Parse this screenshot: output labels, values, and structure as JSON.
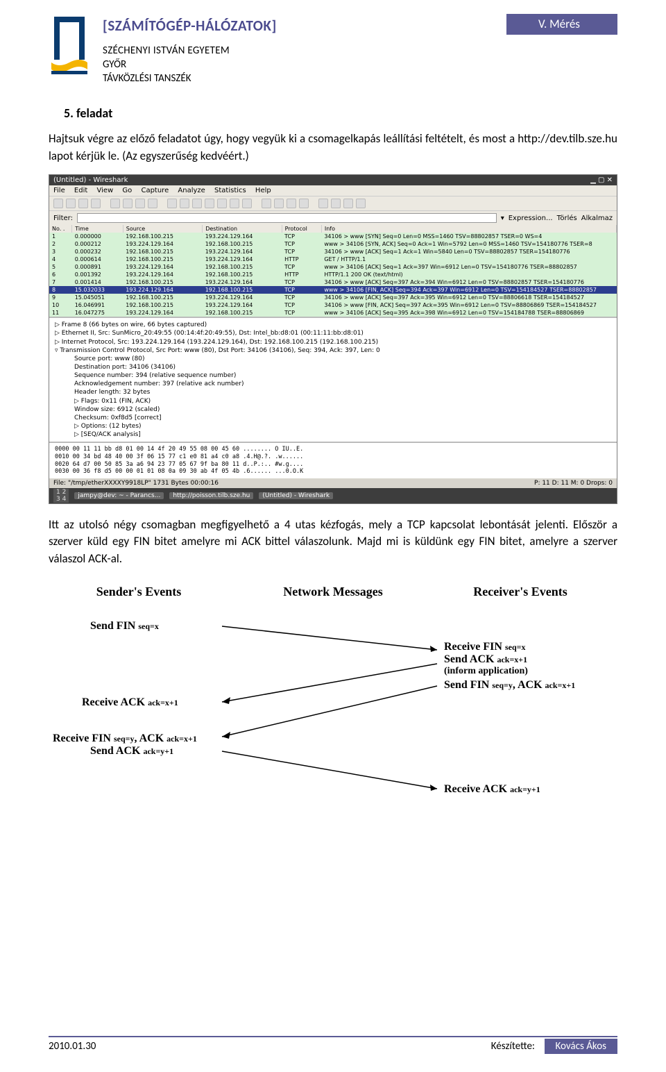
{
  "header": {
    "course_title": "[SZÁMÍTÓGÉP-HÁLÓZATOK]",
    "measurement_label": "V. Mérés",
    "university": "SZÉCHENYI ISTVÁN EGYETEM",
    "city": "GYŐR",
    "department": "TÁVKÖZLÉSI TANSZÉK"
  },
  "task": {
    "heading": "5. feladat",
    "para1": "Hajtsuk végre az előző feladatot úgy, hogy vegyük ki a csomagelkapás leállítási feltételt, és most a http://dev.tilb.sze.hu lapot kérjük le. (Az egyszerűség kedvéért.)",
    "para2": "Itt az utolsó négy csomagban megfigyelhető a 4 utas kézfogás, mely a TCP kapcsolat lebontását jelenti. Először a szerver küld egy FIN bitet amelyre mi ACK bittel válaszolunk. Majd mi is küldünk egy FIN bitet, amelyre a szerver válaszol ACK-al."
  },
  "wireshark": {
    "window_title": "(Untitled) - Wireshark",
    "menu": [
      "File",
      "Edit",
      "View",
      "Go",
      "Capture",
      "Analyze",
      "Statistics",
      "Help"
    ],
    "filter_label": "Filter:",
    "filter_buttons": [
      "Expression...",
      "Törlés",
      "Alkalmaz"
    ],
    "columns": [
      "No. .",
      "Time",
      "Source",
      "Destination",
      "Protocol",
      "Info"
    ],
    "rows": [
      {
        "no": "1",
        "time": "0.000000",
        "src": "192.168.100.215",
        "dst": "193.224.129.164",
        "proto": "TCP",
        "info": "34106 > www [SYN] Seq=0 Len=0 MSS=1460 TSV=88802857 TSER=0 WS=4",
        "cls": "g"
      },
      {
        "no": "2",
        "time": "0.000212",
        "src": "193.224.129.164",
        "dst": "192.168.100.215",
        "proto": "TCP",
        "info": "www > 34106 [SYN, ACK] Seq=0 Ack=1 Win=5792 Len=0 MSS=1460 TSV=154180776 TSER=8",
        "cls": "g"
      },
      {
        "no": "3",
        "time": "0.000232",
        "src": "192.168.100.215",
        "dst": "193.224.129.164",
        "proto": "TCP",
        "info": "34106 > www [ACK] Seq=1 Ack=1 Win=5840 Len=0 TSV=88802857 TSER=154180776",
        "cls": "g"
      },
      {
        "no": "4",
        "time": "0.000614",
        "src": "192.168.100.215",
        "dst": "193.224.129.164",
        "proto": "HTTP",
        "info": "GET / HTTP/1.1",
        "cls": "g"
      },
      {
        "no": "5",
        "time": "0.000891",
        "src": "193.224.129.164",
        "dst": "192.168.100.215",
        "proto": "TCP",
        "info": "www > 34106 [ACK] Seq=1 Ack=397 Win=6912 Len=0 TSV=154180776 TSER=88802857",
        "cls": "g"
      },
      {
        "no": "6",
        "time": "0.001392",
        "src": "193.224.129.164",
        "dst": "192.168.100.215",
        "proto": "HTTP",
        "info": "HTTP/1.1 200 OK (text/html)",
        "cls": "g"
      },
      {
        "no": "7",
        "time": "0.001414",
        "src": "192.168.100.215",
        "dst": "193.224.129.164",
        "proto": "TCP",
        "info": "34106 > www [ACK] Seq=397 Ack=394 Win=6912 Len=0 TSV=88802857 TSER=154180776",
        "cls": "g"
      },
      {
        "no": "8",
        "time": "15.032033",
        "src": "193.224.129.164",
        "dst": "192.168.100.215",
        "proto": "TCP",
        "info": "www > 34106 [FIN, ACK] Seq=394 Ack=397 Win=6912 Len=0 TSV=154184527 TSER=88802857",
        "cls": "sel"
      },
      {
        "no": "9",
        "time": "15.045051",
        "src": "192.168.100.215",
        "dst": "193.224.129.164",
        "proto": "TCP",
        "info": "34106 > www [ACK] Seq=397 Ack=395 Win=6912 Len=0 TSV=88806618 TSER=154184527",
        "cls": "g"
      },
      {
        "no": "10",
        "time": "16.046991",
        "src": "192.168.100.215",
        "dst": "193.224.129.164",
        "proto": "TCP",
        "info": "34106 > www [FIN, ACK] Seq=397 Ack=395 Win=6912 Len=0 TSV=88806869 TSER=154184527",
        "cls": "g"
      },
      {
        "no": "11",
        "time": "16.047275",
        "src": "193.224.129.164",
        "dst": "192.168.100.215",
        "proto": "TCP",
        "info": "www > 34106 [ACK] Seq=395 Ack=398 Win=6912 Len=0 TSV=154184788 TSER=88806869",
        "cls": "g"
      }
    ],
    "tree": [
      "▷ Frame 8 (66 bytes on wire, 66 bytes captured)",
      "▷ Ethernet II, Src: SunMicro_20:49:55 (00:14:4f:20:49:55), Dst: Intel_bb:d8:01 (00:11:11:bb:d8:01)",
      "▷ Internet Protocol, Src: 193.224.129.164 (193.224.129.164), Dst: 192.168.100.215 (192.168.100.215)",
      "▿ Transmission Control Protocol, Src Port: www (80), Dst Port: 34106 (34106), Seq: 394, Ack: 397, Len: 0",
      "Source port: www (80)",
      "Destination port: 34106 (34106)",
      "Sequence number: 394    (relative sequence number)",
      "Acknowledgement number: 397    (relative ack number)",
      "Header length: 32 bytes",
      "▷ Flags: 0x11 (FIN, ACK)",
      "Window size: 6912 (scaled)",
      "Checksum: 0xf8d5 [correct]",
      "▷ Options: (12 bytes)",
      "▷ [SEQ/ACK analysis]"
    ],
    "hex": [
      "0000  00 11 11 bb d8 01 00 14  4f 20 49 55 08 00 45 60   ........ O IU..E.",
      "0010  00 34 bd 48 40 00 3f 06  15 77 c1 e0 81 a4 c0 a8   .4.H@.?. .w......",
      "0020  64 d7 00 50 85 3a a6 94  23 77 05 67 9f ba 80 11   d..P.:.. #w.g....",
      "0030  00 36 f8 d5 00 00 01 01  08 0a 09 30 ab 4f 05 4b   .6...... ...0.O.K"
    ],
    "status_left": "File: \"/tmp/etherXXXXY9918LP\" 1731 Bytes 00:00:16",
    "status_right": "P: 11 D: 11 M: 0 Drops: 0",
    "taskbar_tabs": [
      "jampy@dev: ~ - Parancs...",
      "http://poisson.tilb.sze.hu",
      "(Untitled) - Wireshark"
    ]
  },
  "diagram": {
    "col1": "Sender's Events",
    "col2": "Network Messages",
    "col3": "Receiver's Events",
    "send_fin": "Send FIN seq=x",
    "recv_fin_x": "Receive FIN seq=x",
    "send_ack_x1": "Send ACK ack=x+1",
    "inform": "(inform application)",
    "recv_ack_x1": "Receive ACK ack=x+1",
    "send_fin_y": "Send FIN seq=y, ACK ack=x+1",
    "recv_fin_y": "Receive FIN seq=y, ACK ack=x+1",
    "send_ack_y1": "Send ACK ack=y+1",
    "recv_ack_y1": "Receive ACK ack=y+1"
  },
  "footer": {
    "date": "2010.01.30",
    "made_by_label": "Készítette:",
    "author": "Kovács Ákos"
  }
}
